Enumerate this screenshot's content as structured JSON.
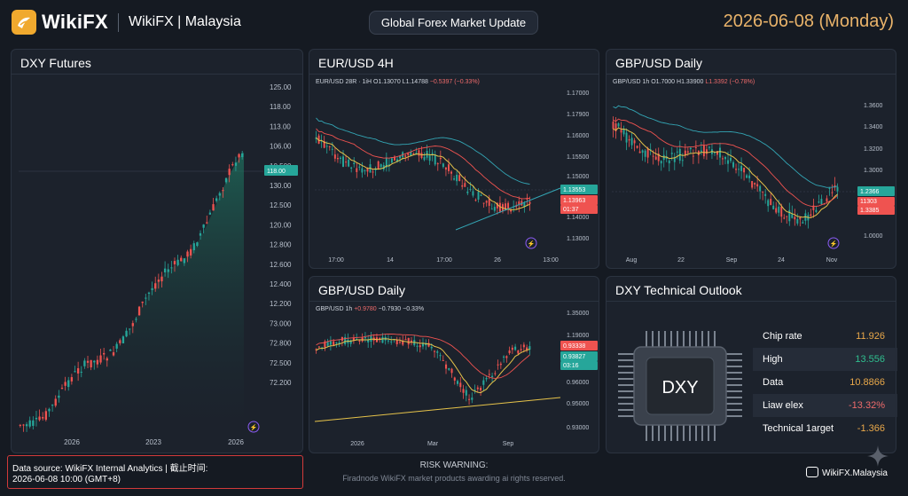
{
  "header": {
    "brand": "WikiFX",
    "site": "WikiFX | Malaysia",
    "pill": "Global Forex Market Update",
    "date": "2026-06-08 (Monday)"
  },
  "panels": {
    "dxy": {
      "title": "DXY Futures",
      "y_ticks": [
        "125.00",
        "118.00",
        "113.00",
        "106.00",
        "10.500",
        "130.00",
        "12.500",
        "120.00",
        "12.800",
        "12.600",
        "12.400",
        "12.200",
        "73.000",
        "72.800",
        "72.500",
        "72.200"
      ],
      "x_ticks": [
        "2026",
        "2023",
        "2026"
      ],
      "price_tag": "118.00"
    },
    "eurusd": {
      "title": "EUR/USD 4H",
      "info_symbol": "EUR/USD 28R · 1iH",
      "info_open": "O1.13070",
      "info_low": "L1.14788",
      "info_change": "−0.5397 (−0.33%)",
      "y_ticks": [
        "1.17000",
        "1.17900",
        "1.16000",
        "1.15500",
        "1.15000",
        "1.14000",
        "1.13000"
      ],
      "x_ticks": [
        "17:00",
        "14",
        "17:00",
        "26",
        "13:00"
      ],
      "tag_green": "1.13553",
      "tag_red": "1.13963",
      "tag_timer": "01:37",
      "tag_low": "1.13000"
    },
    "gbpusd_top": {
      "title": "GBP/USD Daily",
      "info_symbol": "GBP/USD 1h",
      "info_open": "O1.7000",
      "info_high": "H1.33900",
      "info_low": "L1.3392 (−0.78%)",
      "y_ticks": [
        "1.3600",
        "1.3400",
        "1.3200",
        "1.3000",
        "1.0000"
      ],
      "x_ticks": [
        "Aug",
        "22",
        "Sep",
        "24",
        "Nov"
      ],
      "tag_green": "1.2366",
      "tag_red": "11303",
      "tag_red2": "1.3385"
    },
    "gbpusd_bottom": {
      "title": "GBP/USD Daily",
      "info_symbol": "GBP/USD 1h",
      "info_change1": "+0.9780",
      "info_change2": "−0.7930",
      "info_change3": "−0.33%",
      "y_ticks": [
        "1.35000",
        "1.19000",
        "1.10000",
        "0.96000",
        "0.95000",
        "0.93000"
      ],
      "x_ticks": [
        "2026",
        "Mar",
        "Sep"
      ],
      "tag_red": "0.93338",
      "tag_green": "0.93827",
      "tag_timer": "03:16"
    },
    "outlook": {
      "title": "DXY Technical Outlook",
      "chip_label": "DXY",
      "rows": [
        {
          "key": "Chip rate",
          "value": "11.926",
          "color": "#e9a84a"
        },
        {
          "key": "High",
          "value": "13.556",
          "color": "#2fbf8f"
        },
        {
          "key": "Data",
          "value": "10.8866",
          "color": "#e9a84a"
        },
        {
          "key": "Liaw elex",
          "value": "-13.32%",
          "color": "#ef6b6b"
        },
        {
          "key": "Technical 1arget",
          "value": "-1.366",
          "color": "#e9a84a"
        }
      ]
    }
  },
  "footer": {
    "source_line1": "Data source: WikiFX Internal Analytics | 截止时间:",
    "source_line2": "2026-06-08 10:00 (GMT+8)",
    "risk_title": "RISK WARNING:",
    "risk_text": "Firadnode WikiFX market products awarding ai rights reserved.",
    "watermark": "WikiFX.Malaysia"
  },
  "colors": {
    "up": "#26a69a",
    "down": "#ef5350",
    "accent": "#e9b36a"
  }
}
